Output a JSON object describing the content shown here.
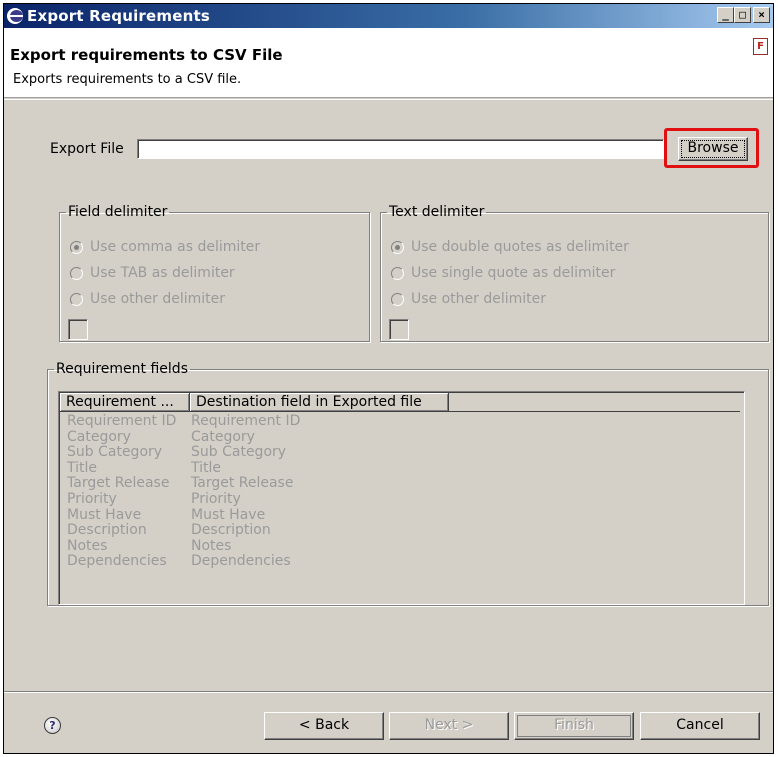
{
  "window": {
    "title": "Export Requirements",
    "controls": {
      "minimize": "_",
      "maximize": "□",
      "close": "×"
    }
  },
  "header": {
    "title": "Export requirements to CSV File",
    "description": "Exports requirements to a CSV file."
  },
  "export_file": {
    "label": "Export File",
    "value": "",
    "browse_label": "Browse"
  },
  "field_delimiter": {
    "legend": "Field delimiter",
    "options": [
      "Use comma as delimiter",
      "Use TAB as delimiter",
      "Use other delimiter"
    ],
    "selected": "Use comma as delimiter"
  },
  "text_delimiter": {
    "legend": "Text delimiter",
    "options": [
      "Use double quotes as delimiter",
      "Use single quote as delimiter",
      "Use other delimiter"
    ],
    "selected": "Use double quotes as delimiter"
  },
  "requirement_fields": {
    "legend": "Requirement fields",
    "columns": [
      "Requirement ...",
      "Destination field in Exported file",
      ""
    ],
    "rows": [
      [
        "Requirement ID",
        "Requirement ID"
      ],
      [
        "Category",
        "Category"
      ],
      [
        "Sub Category",
        "Sub Category"
      ],
      [
        "Title",
        "Title"
      ],
      [
        "Target Release",
        "Target Release"
      ],
      [
        "Priority",
        "Priority"
      ],
      [
        "Must Have",
        "Must Have"
      ],
      [
        "Description",
        "Description"
      ],
      [
        "Notes",
        "Notes"
      ],
      [
        "Dependencies",
        "Dependencies"
      ]
    ]
  },
  "footer": {
    "help_icon": "?",
    "back_label": "< Back",
    "next_label": "Next >",
    "finish_label": "Finish",
    "cancel_label": "Cancel"
  },
  "colors": {
    "highlight": "#e01010",
    "titlebar": "#0a246a",
    "dialog_bg": "#d4d0c8"
  }
}
